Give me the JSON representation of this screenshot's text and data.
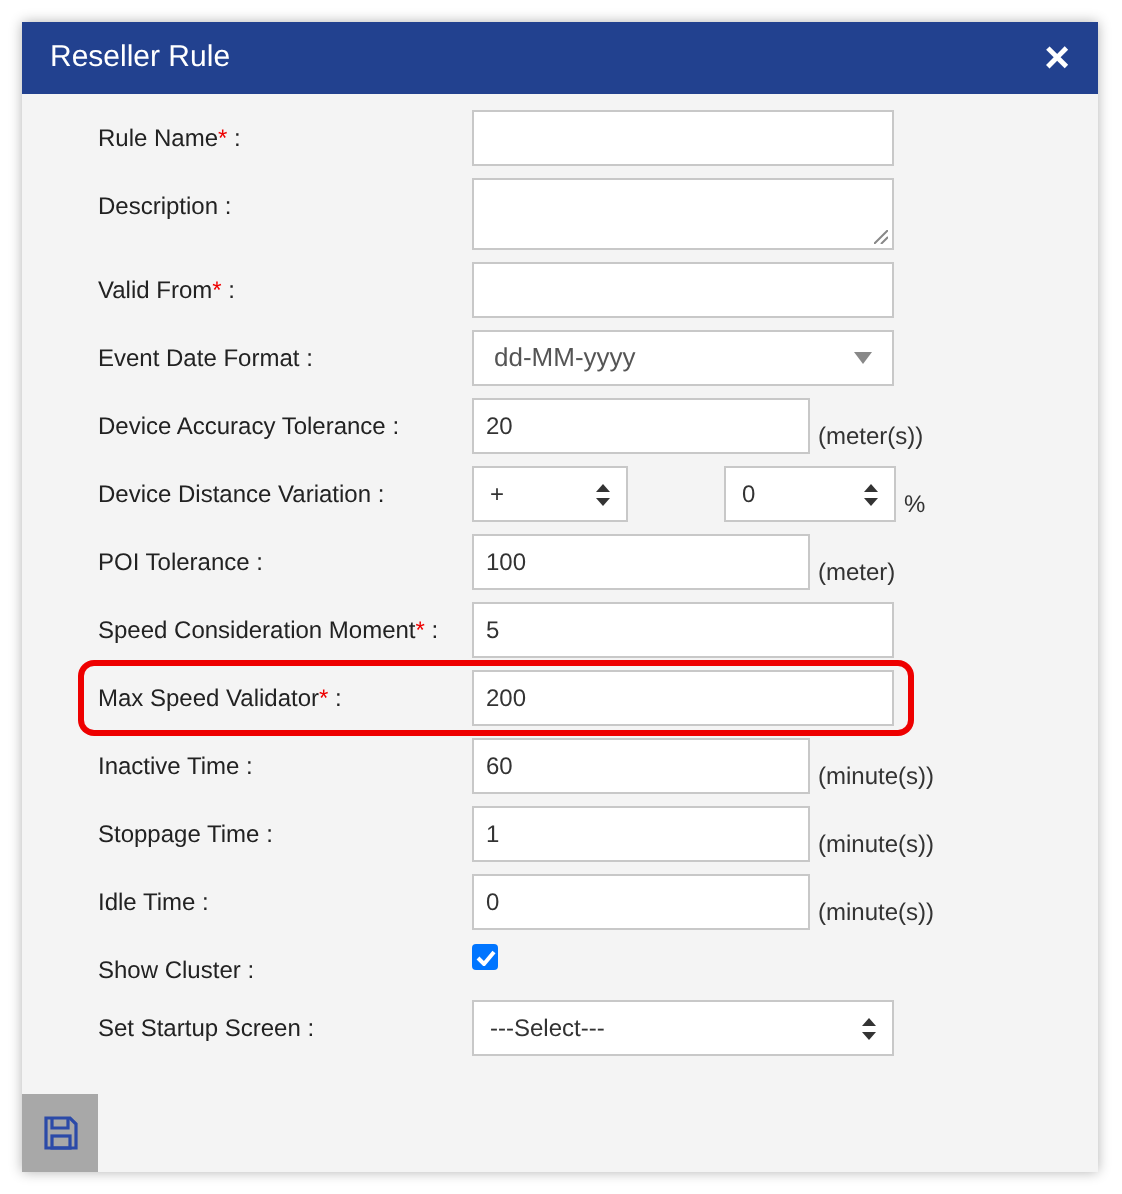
{
  "window": {
    "title": "Reseller Rule",
    "close": "×"
  },
  "fields": [
    {
      "kind": "text",
      "label": "Rule Name",
      "required": true,
      "colon": ":",
      "highlighted": false
    },
    {
      "kind": "textarea",
      "label": "Description",
      "required": false,
      "colon": ":",
      "highlighted": false
    },
    {
      "kind": "text",
      "label": "Valid From",
      "required": true,
      "colon": ":",
      "highlighted": false
    },
    {
      "kind": "dropdown",
      "label": "Event Date Format",
      "required": false,
      "colon": ":",
      "value": "dd-MM-yyyy",
      "highlighted": false
    },
    {
      "kind": "text",
      "label": "Device Accuracy Tolerance",
      "required": false,
      "colon": ":",
      "value": "20",
      "unit": "(meter(s))",
      "highlighted": false
    },
    {
      "kind": "pair",
      "label": "Device Distance Variation",
      "required": false,
      "colon": ":",
      "value": "+",
      "value_2": "0",
      "unit": "%",
      "highlighted": false
    },
    {
      "kind": "text",
      "label": "POI Tolerance",
      "required": false,
      "colon": ":",
      "value": "100",
      "unit": "(meter)",
      "highlighted": false
    },
    {
      "kind": "text",
      "label": "Speed Consideration Moment",
      "required": true,
      "colon": ":",
      "value": "5",
      "highlighted": false
    },
    {
      "kind": "text",
      "label": "Max Speed Validator",
      "required": true,
      "colon": ":",
      "value": "200",
      "highlighted": true
    },
    {
      "kind": "text",
      "label": "Inactive Time",
      "required": false,
      "colon": ":",
      "value": "60",
      "unit": "(minute(s))",
      "highlighted": false
    },
    {
      "kind": "text",
      "label": "Stoppage Time",
      "required": false,
      "colon": ":",
      "value": "1",
      "unit": "(minute(s))",
      "highlighted": false
    },
    {
      "kind": "text",
      "label": "Idle Time",
      "required": false,
      "colon": ":",
      "value": "0",
      "unit": "(minute(s))",
      "highlighted": false
    },
    {
      "kind": "checkbox",
      "label": "Show Cluster",
      "required": false,
      "colon": ":",
      "checked": true,
      "highlighted": false
    },
    {
      "kind": "spin",
      "label": "Set Startup Screen",
      "required": false,
      "colon": ":",
      "value": "---Select---",
      "highlighted": false
    }
  ],
  "required_mark": "*"
}
